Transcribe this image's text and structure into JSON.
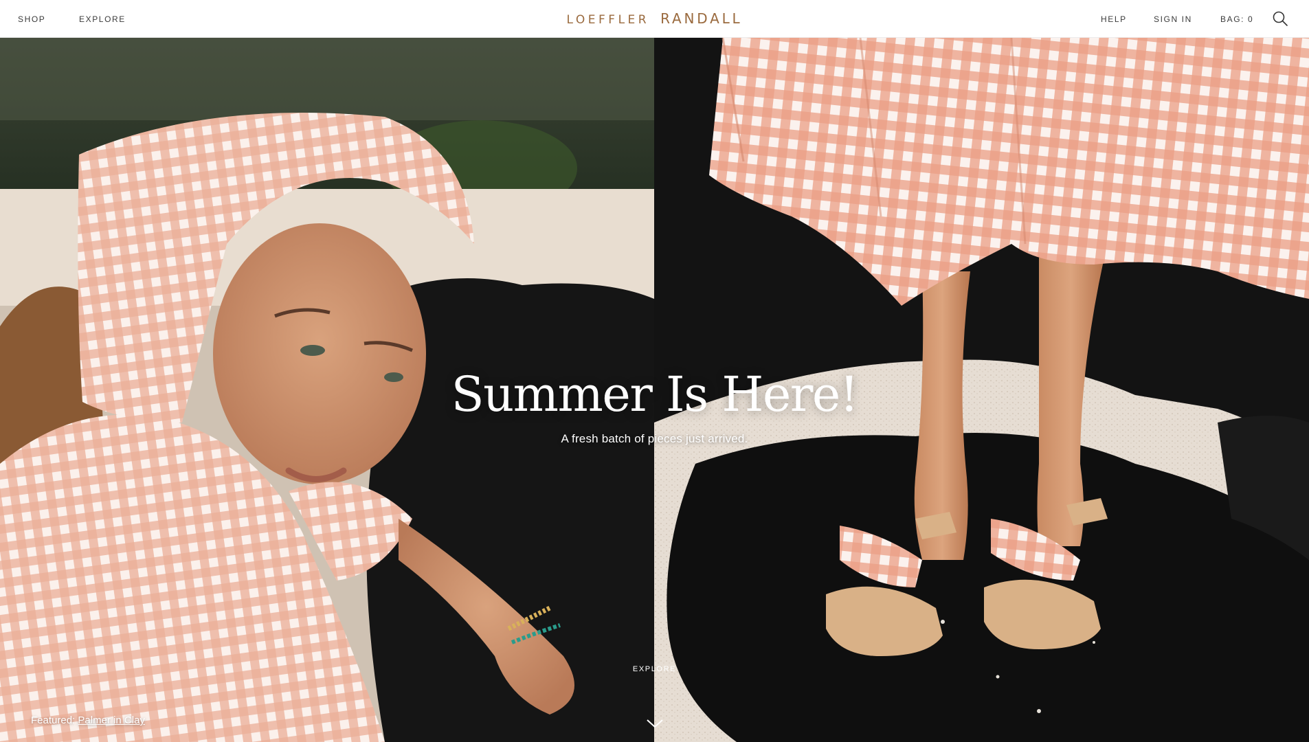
{
  "header": {
    "nav_left": [
      "SHOP",
      "EXPLORE"
    ],
    "logo_first": "LOEFFLER",
    "logo_second": "RANDALL",
    "nav_right": {
      "help": "HELP",
      "sign_in": "SIGN IN",
      "bag": "BAG: 0"
    },
    "search_icon": "search-icon"
  },
  "hero": {
    "title": "Summer Is Here!",
    "subtitle": "A fresh batch of pieces just arrived.",
    "explore": "EXPLORE",
    "scroll_icon": "chevron-down-icon"
  },
  "featured": {
    "label": "Featured:",
    "link": "Palmer in Clay"
  },
  "colors": {
    "logo": "#9a6a3e",
    "gingham": "#e9a48c",
    "rock": "#141414",
    "sand": "#e8ddd0"
  }
}
